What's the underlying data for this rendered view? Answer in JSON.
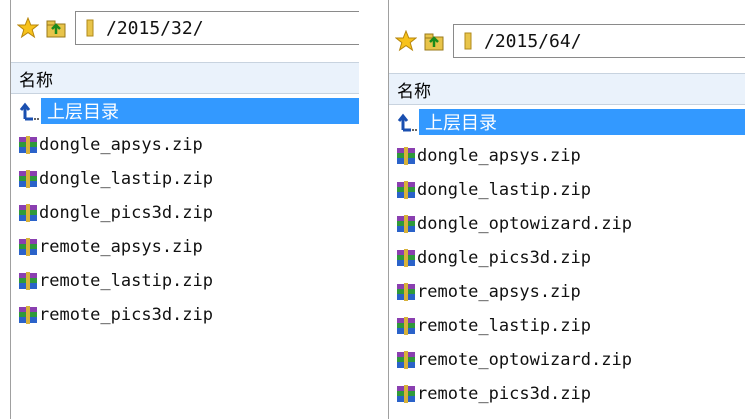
{
  "panels": [
    {
      "path": "/2015/32/",
      "column_header": "名称",
      "parent_dir_label": "上层目录",
      "files": [
        "dongle_apsys.zip",
        "dongle_lastip.zip",
        "dongle_pics3d.zip",
        "remote_apsys.zip",
        "remote_lastip.zip",
        "remote_pics3d.zip"
      ]
    },
    {
      "path": "/2015/64/",
      "column_header": "名称",
      "parent_dir_label": "上层目录",
      "files": [
        "dongle_apsys.zip",
        "dongle_lastip.zip",
        "dongle_optowizard.zip",
        "dongle_pics3d.zip",
        "remote_apsys.zip",
        "remote_lastip.zip",
        "remote_optowizard.zip",
        "remote_pics3d.zip"
      ]
    }
  ],
  "icons": {
    "favorite": "star-icon",
    "up_folder": "up-folder-icon",
    "folder": "folder-icon",
    "parent": "parent-dir-arrow-icon",
    "file": "zip-archive-icon"
  },
  "colors": {
    "selection": "#3399ff",
    "header_bg": "#eaf2fb"
  }
}
